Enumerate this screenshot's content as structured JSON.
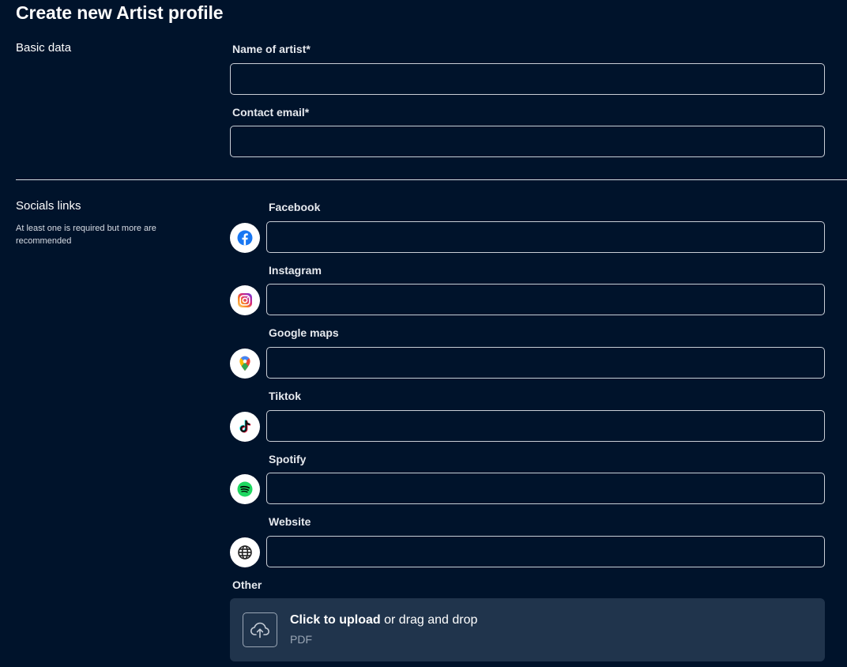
{
  "page": {
    "title": "Create new Artist profile"
  },
  "basic_data": {
    "title": "Basic data",
    "name_label": "Name of artist*",
    "name_value": "",
    "email_label": "Contact email*",
    "email_value": ""
  },
  "socials": {
    "title": "Socials links",
    "description": "At least one is required but more are recommended",
    "links": [
      {
        "label": "Facebook",
        "icon": "facebook-icon",
        "value": ""
      },
      {
        "label": "Instagram",
        "icon": "instagram-icon",
        "value": ""
      },
      {
        "label": "Google maps",
        "icon": "google-maps-icon",
        "value": ""
      },
      {
        "label": "Tiktok",
        "icon": "tiktok-icon",
        "value": ""
      },
      {
        "label": "Spotify",
        "icon": "spotify-icon",
        "value": ""
      },
      {
        "label": "Website",
        "icon": "globe-icon",
        "value": ""
      }
    ]
  },
  "other": {
    "label": "Other",
    "upload_action": "Click to upload",
    "upload_rest": " or drag and drop",
    "upload_hint": "PDF",
    "icon": "cloud-upload-icon"
  },
  "colors": {
    "background": "#00132b",
    "input_border": "#c9ced6",
    "upload_background": "#20344c",
    "facebook": "#1877f2",
    "spotify": "#1ed760"
  }
}
